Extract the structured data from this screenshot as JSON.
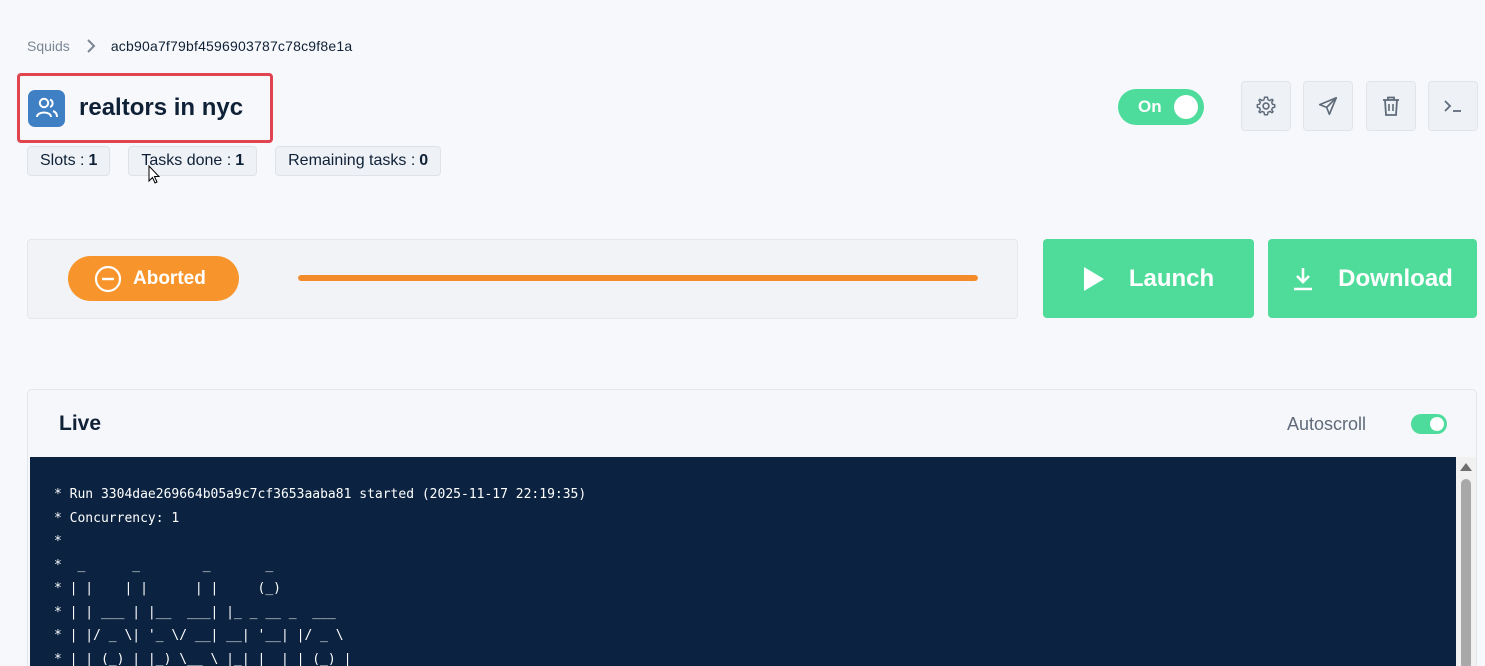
{
  "breadcrumb": {
    "root": "Squids",
    "current": "acb90a7f79bf4596903787c78c9f8e1a"
  },
  "header": {
    "title": "realtors in nyc",
    "icon": "users-icon",
    "toggle_label": "On"
  },
  "stats": [
    {
      "label": "Slots :",
      "value": "1"
    },
    {
      "label": "Tasks done :",
      "value": "1"
    },
    {
      "label": "Remaining tasks :",
      "value": "0"
    }
  ],
  "toolbar": [
    "gear-icon",
    "send-icon",
    "trash-icon",
    "terminal-icon"
  ],
  "status": {
    "label": "Aborted",
    "progress": 1.0,
    "color": "#f7952c"
  },
  "actions": {
    "launch_label": "Launch",
    "download_label": "Download",
    "accent": "#4fdc9a"
  },
  "live": {
    "title": "Live",
    "autoscroll_label": "Autoscroll",
    "autoscroll_on": true,
    "log": "* Run 3304dae269664b05a9c7cf3653aaba81 started (2025-11-17 22:19:35)\n* Concurrency: 1\n*\n*  _      _        _       _\n* | |    | |      | |     (_)\n* | | ___ | |__  ___| |_ _ __ _  ___\n* | |/ _ \\| '_ \\/ __| __| '__| |/ _ \\\n* | | (_) | |_) \\__ \\ |_| |  | | (_) |"
  }
}
